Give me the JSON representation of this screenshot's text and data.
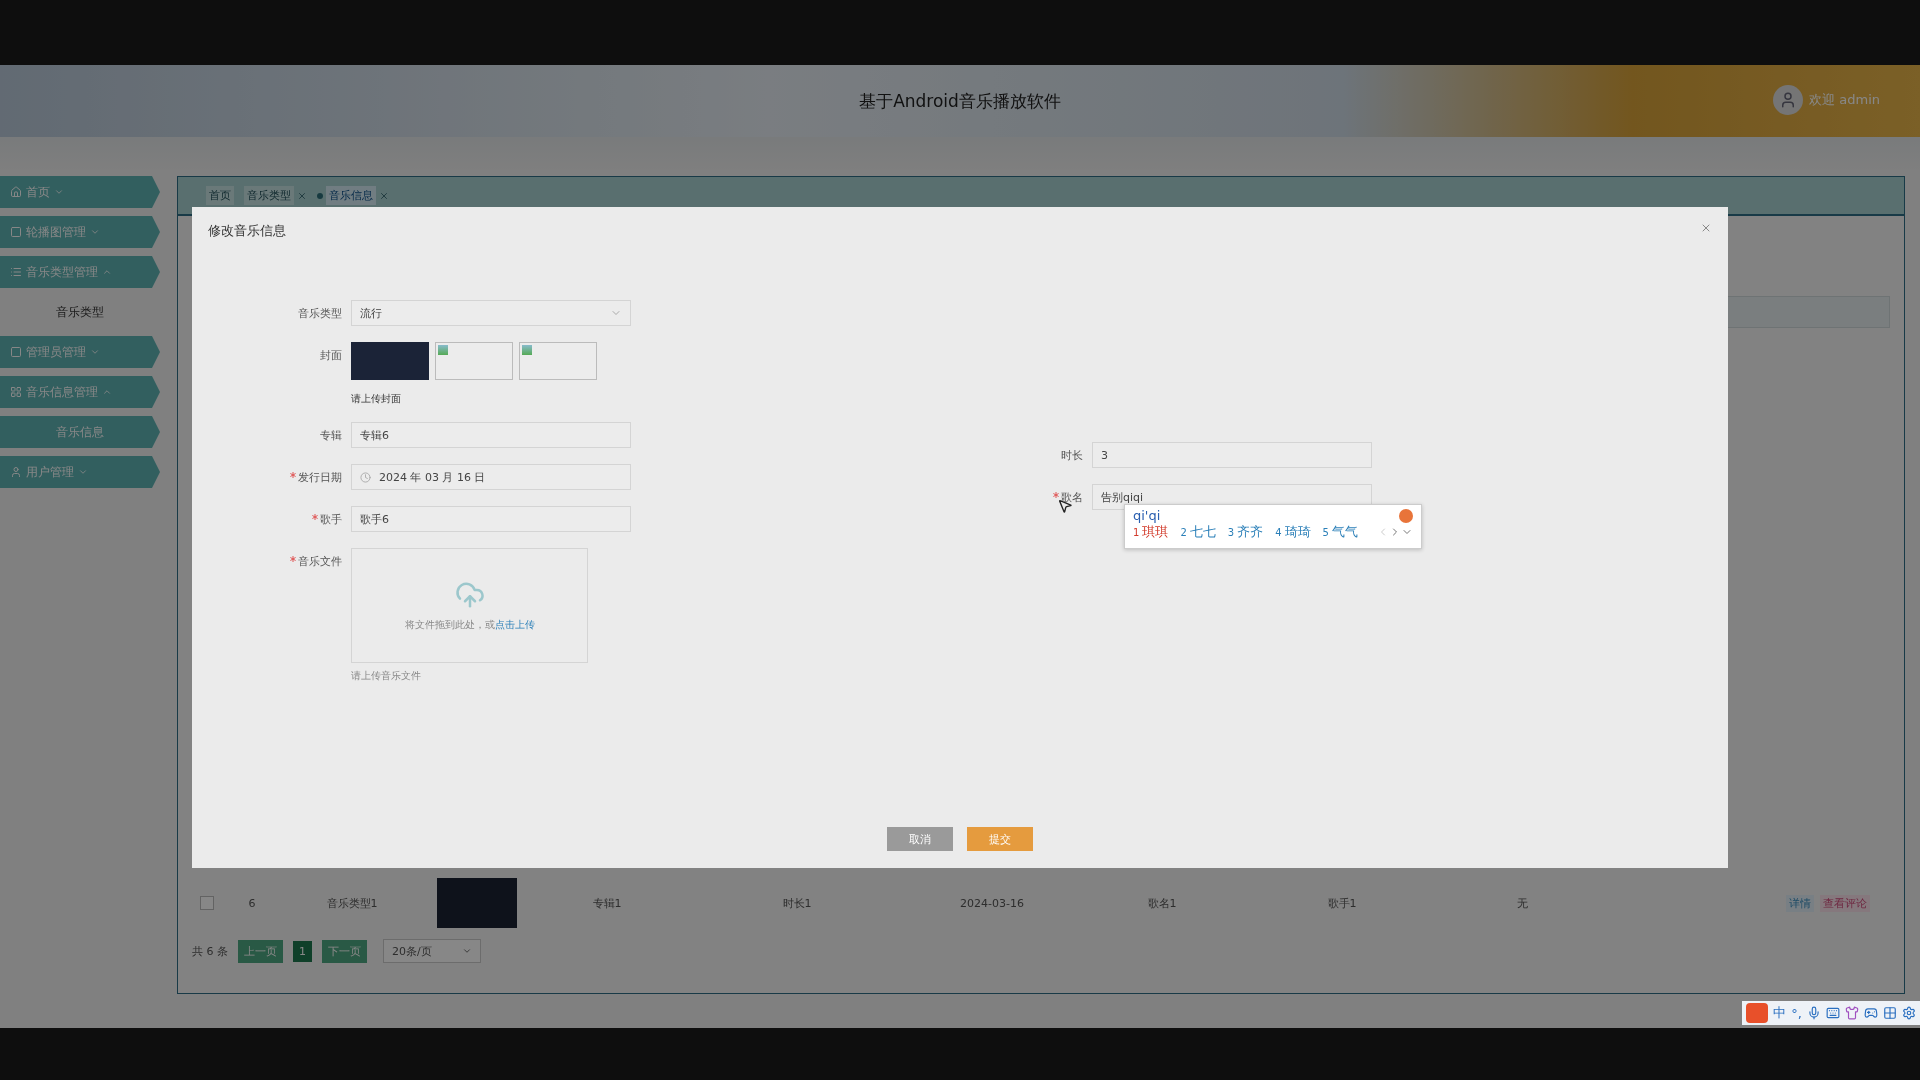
{
  "header": {
    "title": "基于Android音乐播放软件",
    "welcome": "欢迎 admin"
  },
  "sidebar": {
    "items": [
      {
        "label": "首页",
        "expanded": false
      },
      {
        "label": "轮播图管理",
        "expanded": false
      },
      {
        "label": "音乐类型管理",
        "expanded": true,
        "children": [
          {
            "label": "音乐类型",
            "selected": false
          }
        ]
      },
      {
        "label": "管理员管理",
        "expanded": false
      },
      {
        "label": "音乐信息管理",
        "expanded": true,
        "children": [
          {
            "label": "音乐信息",
            "selected": true
          }
        ]
      },
      {
        "label": "用户管理",
        "expanded": false
      }
    ]
  },
  "tabs": [
    {
      "label": "首页",
      "selected": false,
      "closable": false
    },
    {
      "label": "音乐类型",
      "selected": false,
      "closable": true
    },
    {
      "label": "音乐信息",
      "selected": true,
      "closable": true
    }
  ],
  "table": {
    "rows": [
      {
        "checked": false,
        "cells": [
          "6",
          "音乐类型1",
          "专辑1",
          "时长1",
          "2024-03-16",
          "歌名1",
          "歌手1",
          "无"
        ],
        "actions": [
          "详情",
          "查看评论"
        ]
      }
    ]
  },
  "pagination": {
    "total": "共 6 条",
    "prev": "上一页",
    "pages": [
      {
        "label": "1",
        "selected": true
      }
    ],
    "next": "下一页",
    "page_size": "20条/页"
  },
  "dialog": {
    "title": "修改音乐信息",
    "left_fields": [
      {
        "kind": "select",
        "label": "音乐类型",
        "required": false,
        "value": "流行"
      },
      {
        "kind": "images",
        "label": "封面",
        "required": false,
        "images": [
          {
            "broken": false
          },
          {
            "broken": true
          },
          {
            "broken": true
          }
        ],
        "hint": "请上传封面"
      },
      {
        "kind": "text",
        "label": "专辑",
        "required": false,
        "value": "专辑6"
      },
      {
        "kind": "date",
        "label": "发行日期",
        "required": true,
        "value": "2024 年 03 月 16 日"
      },
      {
        "kind": "text",
        "label": "歌手",
        "required": true,
        "value": "歌手6"
      },
      {
        "kind": "upload",
        "label": "音乐文件",
        "required": true,
        "drop_text": "将文件拖到此处，或",
        "link": "点击上传",
        "hint": "请上传音乐文件"
      }
    ],
    "right_fields": [
      {
        "kind": "text",
        "label": "时长",
        "required": false,
        "value": "3"
      },
      {
        "kind": "text",
        "label": "歌名",
        "required": true,
        "value": "告别qiqi",
        "ime": true
      }
    ],
    "buttons": [
      {
        "kind": "cancel",
        "label": "取消"
      },
      {
        "kind": "submit",
        "label": "提交"
      }
    ]
  },
  "ime": {
    "composition": "qi'qi",
    "candidates": [
      {
        "index": "1",
        "text": "琪琪",
        "selected": true
      },
      {
        "index": "2",
        "text": "七七",
        "selected": false
      },
      {
        "index": "3",
        "text": "齐齐",
        "selected": false
      },
      {
        "index": "4",
        "text": "琦琦",
        "selected": false
      },
      {
        "index": "5",
        "text": "气气",
        "selected": false
      }
    ],
    "toolbar_mode": "中",
    "toolbar_punct": "°,"
  }
}
